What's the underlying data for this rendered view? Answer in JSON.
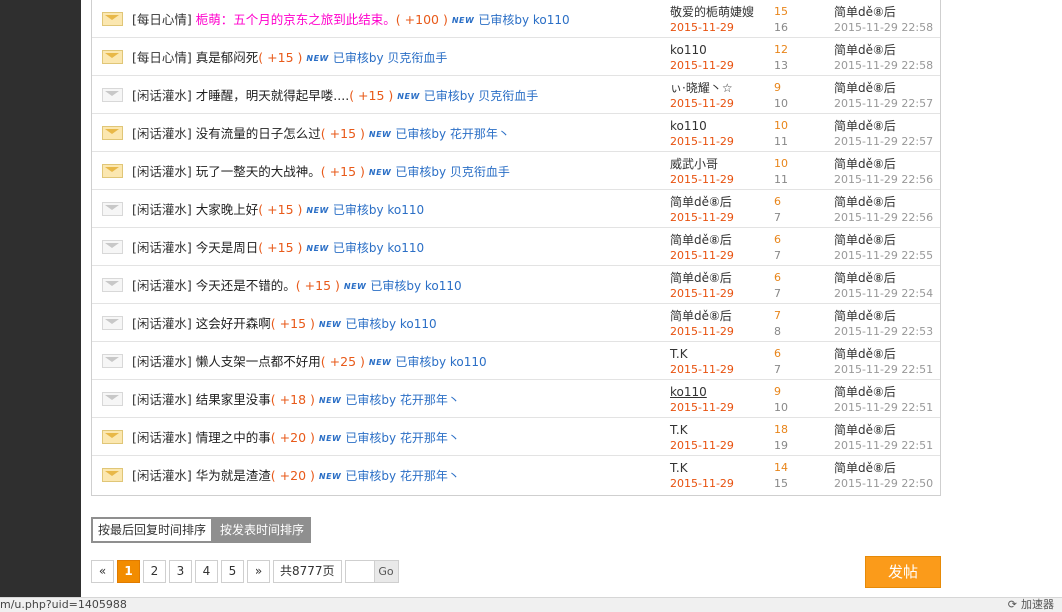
{
  "threads": [
    {
      "folder": "hot",
      "category": "每日心情",
      "subject": "栀萌：五个月的京东之旅到此结束。",
      "subject_style": "pink",
      "reward": "( +100 )",
      "badge": "NEW",
      "approved": "已审核by ko110",
      "author": "敬爱的栀萌婕嫂",
      "author_underline": false,
      "post_date": "2015-11-29",
      "replies": "15",
      "views": "16",
      "last_poster": "简单dě⑧后",
      "last_time": "2015-11-29 22:58"
    },
    {
      "folder": "hot",
      "category": "每日心情",
      "subject": "真是郁闷死",
      "subject_style": "normal",
      "reward": "( +15 )",
      "badge": "NEW",
      "approved": "已审核by 贝克衔血手",
      "author": "ko110",
      "author_underline": false,
      "post_date": "2015-11-29",
      "replies": "12",
      "views": "13",
      "last_poster": "简单dě⑧后",
      "last_time": "2015-11-29 22:58"
    },
    {
      "folder": "normal",
      "category": "闲话灌水",
      "subject": "才睡醒，明天就得起早喽....",
      "subject_style": "normal",
      "reward": "( +15 )",
      "badge": "NEW",
      "approved": "已审核by 贝克衔血手",
      "author": "ぃ·晓耀丶☆",
      "author_underline": false,
      "post_date": "2015-11-29",
      "replies": "9",
      "views": "10",
      "last_poster": "简单dě⑧后",
      "last_time": "2015-11-29 22:57"
    },
    {
      "folder": "hot",
      "category": "闲话灌水",
      "subject": "没有流量的日子怎么过",
      "subject_style": "normal",
      "reward": "( +15 )",
      "badge": "NEW",
      "approved": "已审核by 花开那年丶",
      "author": "ko110",
      "author_underline": false,
      "post_date": "2015-11-29",
      "replies": "10",
      "views": "11",
      "last_poster": "简单dě⑧后",
      "last_time": "2015-11-29 22:57"
    },
    {
      "folder": "hot",
      "category": "闲话灌水",
      "subject": "玩了一整天的大战神。",
      "subject_style": "normal",
      "reward": "( +15 )",
      "badge": "NEW",
      "approved": "已审核by 贝克衔血手",
      "author": "威武小哥",
      "author_underline": false,
      "post_date": "2015-11-29",
      "replies": "10",
      "views": "11",
      "last_poster": "简单dě⑧后",
      "last_time": "2015-11-29 22:56"
    },
    {
      "folder": "normal",
      "category": "闲话灌水",
      "subject": "大家晚上好",
      "subject_style": "normal",
      "reward": "( +15 )",
      "badge": "NEW",
      "approved": "已审核by ko110",
      "author": "简单dě⑧后",
      "author_underline": false,
      "post_date": "2015-11-29",
      "replies": "6",
      "views": "7",
      "last_poster": "简单dě⑧后",
      "last_time": "2015-11-29 22:56"
    },
    {
      "folder": "normal",
      "category": "闲话灌水",
      "subject": "今天是周日",
      "subject_style": "normal",
      "reward": "( +15 )",
      "badge": "NEW",
      "approved": "已审核by ko110",
      "author": "简单dě⑧后",
      "author_underline": false,
      "post_date": "2015-11-29",
      "replies": "6",
      "views": "7",
      "last_poster": "简单dě⑧后",
      "last_time": "2015-11-29 22:55"
    },
    {
      "folder": "normal",
      "category": "闲话灌水",
      "subject": "今天还是不错的。",
      "subject_style": "normal",
      "reward": "( +15 )",
      "badge": "NEW",
      "approved": "已审核by ko110",
      "author": "简单dě⑧后",
      "author_underline": false,
      "post_date": "2015-11-29",
      "replies": "6",
      "views": "7",
      "last_poster": "简单dě⑧后",
      "last_time": "2015-11-29 22:54"
    },
    {
      "folder": "normal",
      "category": "闲话灌水",
      "subject": "这会好开森啊",
      "subject_style": "normal",
      "reward": "( +15 )",
      "badge": "NEW",
      "approved": "已审核by ko110",
      "author": "简单dě⑧后",
      "author_underline": false,
      "post_date": "2015-11-29",
      "replies": "7",
      "views": "8",
      "last_poster": "简单dě⑧后",
      "last_time": "2015-11-29 22:53"
    },
    {
      "folder": "normal",
      "category": "闲话灌水",
      "subject": "懒人支架一点都不好用",
      "subject_style": "normal",
      "reward": "( +25 )",
      "badge": "NEW",
      "approved": "已审核by ko110",
      "author": "T.K",
      "author_underline": false,
      "post_date": "2015-11-29",
      "replies": "6",
      "views": "7",
      "last_poster": "简单dě⑧后",
      "last_time": "2015-11-29 22:51"
    },
    {
      "folder": "normal",
      "category": "闲话灌水",
      "subject": "结果家里没事",
      "subject_style": "normal",
      "reward": "( +18 )",
      "badge": "NEW",
      "approved": "已审核by 花开那年丶",
      "author": "ko110",
      "author_underline": true,
      "post_date": "2015-11-29",
      "replies": "9",
      "views": "10",
      "last_poster": "简单dě⑧后",
      "last_time": "2015-11-29 22:51"
    },
    {
      "folder": "hot",
      "category": "闲话灌水",
      "subject": "情理之中的事",
      "subject_style": "normal",
      "reward": "( +20 )",
      "badge": "NEW",
      "approved": "已审核by 花开那年丶",
      "author": "T.K",
      "author_underline": false,
      "post_date": "2015-11-29",
      "replies": "18",
      "views": "19",
      "last_poster": "简单dě⑧后",
      "last_time": "2015-11-29 22:51"
    },
    {
      "folder": "hot",
      "category": "闲话灌水",
      "subject": "华为就是渣渣",
      "subject_style": "normal",
      "reward": "( +20 )",
      "badge": "NEW",
      "approved": "已审核by 花开那年丶",
      "author": "T.K",
      "author_underline": false,
      "post_date": "2015-11-29",
      "replies": "14",
      "views": "15",
      "last_poster": "简单dě⑧后",
      "last_time": "2015-11-29 22:50"
    }
  ],
  "sort": {
    "by_last_reply": "按最后回复时间排序",
    "by_post_time": "按发表时间排序",
    "active": "by_post_time"
  },
  "pager": {
    "prev": "«",
    "pages": [
      "1",
      "2",
      "3",
      "4",
      "5"
    ],
    "current": "1",
    "next": "»",
    "total": "共8777页",
    "goto_value": "",
    "goto_label": "Go"
  },
  "post_button": "发帖",
  "status_bar": {
    "url": "m/u.php?uid=1405988",
    "right": "加速器"
  },
  "colors": {
    "accent_orange": "#fb9b1a",
    "current_page": "#f28c00",
    "link_blue": "#2b6fc6",
    "date_red": "#e8510e",
    "pink_title": "#ff00cc"
  }
}
